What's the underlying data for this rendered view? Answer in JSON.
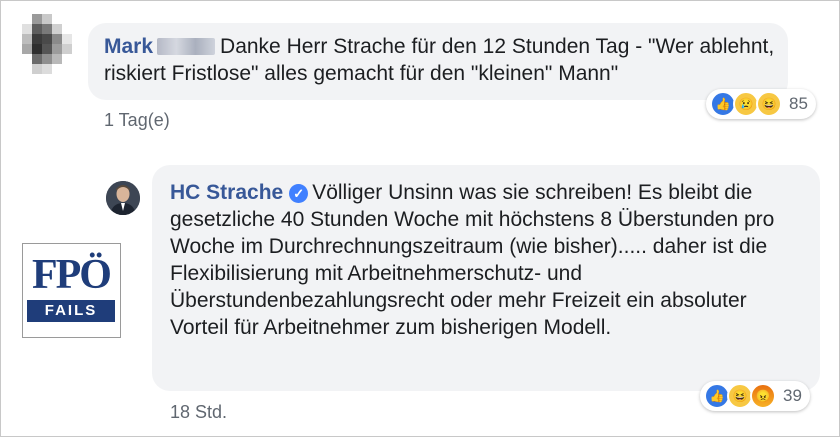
{
  "comments": [
    {
      "author": "Mark",
      "text": "Danke Herr Strache für den 12 Stunden Tag - \"Wer ablehnt, riskiert Fristlose\" alles gemacht für den \"kleinen\" Mann\"",
      "time": "1 Tag(e)",
      "reactions": {
        "icons": [
          "like-icon",
          "sad-icon",
          "haha-icon"
        ],
        "count": "85"
      }
    },
    {
      "author": "HC Strache",
      "verified": true,
      "text": "Völliger Unsinn was sie schreiben! Es bleibt die gesetzliche 40 Stunden Woche mit höchstens 8 Überstunden pro Woche im Durchrechnungszeitraum (wie bisher)..... daher ist die Flexibilisierung mit Arbeitnehmerschutz- und Überstundenbezahlungsrecht oder mehr Freizeit ein absoluter Vorteil für Arbeitnehmer zum bisherigen Modell.",
      "time": "18 Std.",
      "reactions": {
        "icons": [
          "like-icon",
          "haha-icon",
          "angry-icon"
        ],
        "count": "39"
      }
    }
  ],
  "watermark": {
    "line1": "FPÖ",
    "line2": "FAILS"
  },
  "colors": {
    "name": "#385898",
    "bubble": "#f2f3f5",
    "meta": "#606770",
    "logo": "#1f3d7a"
  }
}
